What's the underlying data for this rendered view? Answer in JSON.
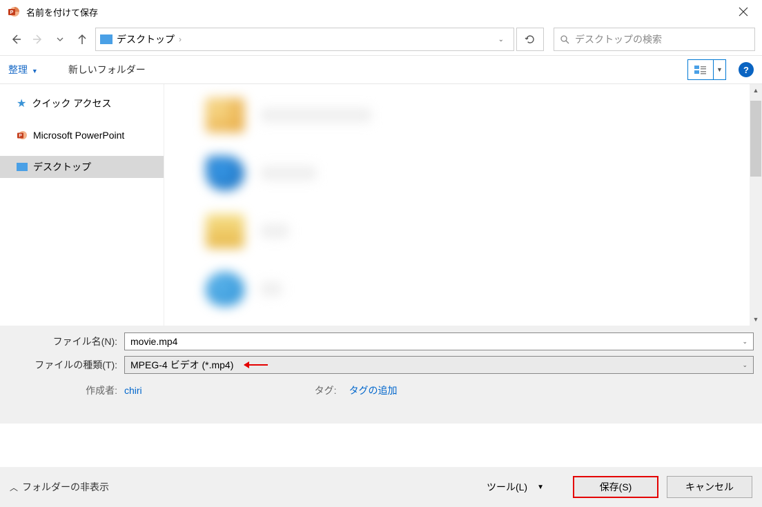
{
  "titlebar": {
    "title": "名前を付けて保存"
  },
  "breadcrumb": {
    "location": "デスクトップ"
  },
  "search": {
    "placeholder": "デスクトップの検索"
  },
  "toolbar": {
    "organize": "整理",
    "newfolder": "新しいフォルダー"
  },
  "sidebar": {
    "items": [
      {
        "label": "クイック アクセス"
      },
      {
        "label": "Microsoft PowerPoint"
      },
      {
        "label": "デスクトップ"
      }
    ]
  },
  "form": {
    "filename_label": "ファイル名(N):",
    "filename_value": "movie.mp4",
    "filetype_label": "ファイルの種類(T):",
    "filetype_value": "MPEG-4 ビデオ (*.mp4)"
  },
  "meta": {
    "author_label": "作成者:",
    "author_value": "chiri",
    "tag_label": "タグ:",
    "tag_value": "タグの追加"
  },
  "footer": {
    "hide_folders": "フォルダーの非表示",
    "tools": "ツール(L)",
    "save": "保存(S)",
    "cancel": "キャンセル"
  }
}
